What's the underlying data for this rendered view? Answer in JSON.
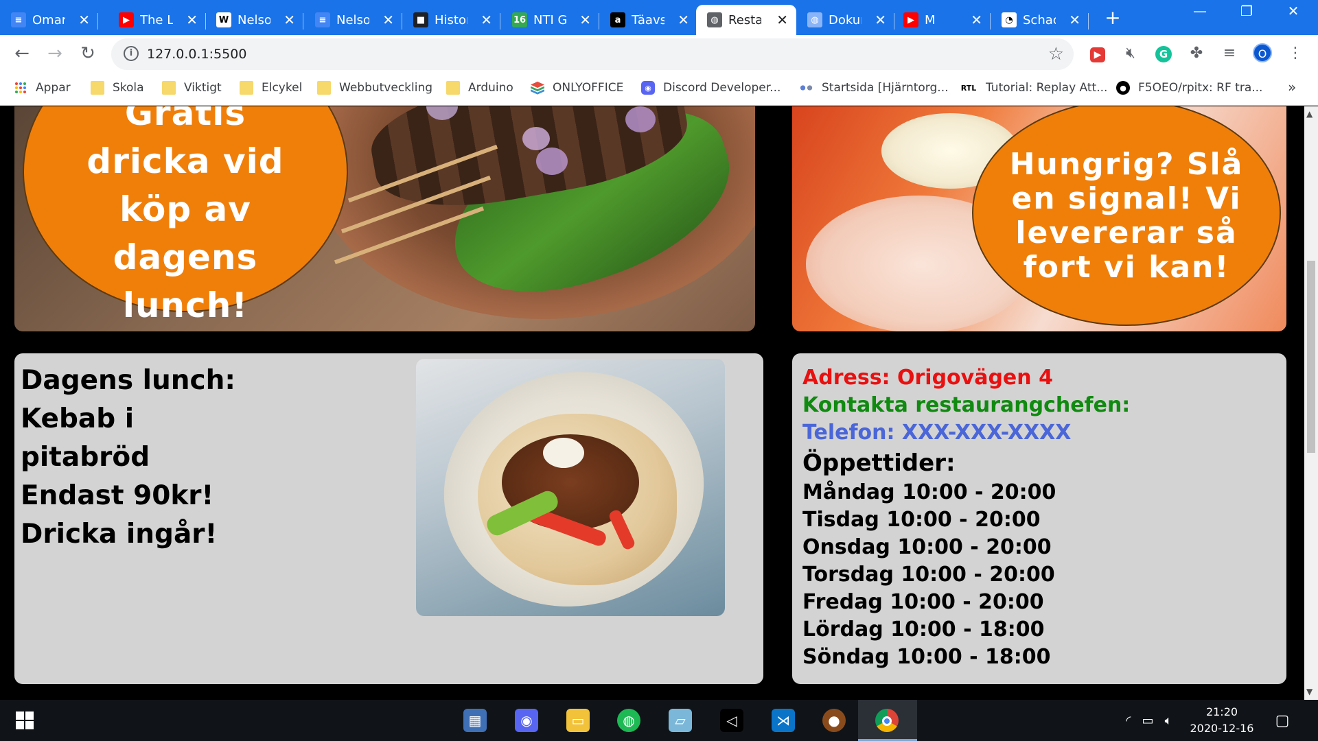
{
  "browser": {
    "tabs": [
      {
        "label": "Omar",
        "icon": "docs-icon",
        "color": "#4285f4",
        "glyph": "≡"
      },
      {
        "label": "The Li",
        "icon": "youtube-icon",
        "color": "#ff0000",
        "glyph": "▶"
      },
      {
        "label": "Nelso",
        "icon": "wikipedia-icon",
        "color": "#ffffff",
        "glyph": "W"
      },
      {
        "label": "Nelso",
        "icon": "docs-icon",
        "color": "#4285f4",
        "glyph": "≡"
      },
      {
        "label": "Histor",
        "icon": "profile-icon",
        "color": "#202124",
        "glyph": "■"
      },
      {
        "label": "NTI G",
        "icon": "calendar-icon",
        "color": "#34a853",
        "glyph": "16"
      },
      {
        "label": "Täavsl",
        "icon": "amazon-icon",
        "color": "#000000",
        "glyph": "a"
      },
      {
        "label": "Restau",
        "icon": "globe-icon",
        "color": "#5f6368",
        "glyph": "◍",
        "active": true
      },
      {
        "label": "Dokum",
        "icon": "globe-icon",
        "color": "#8ab4f8",
        "glyph": "◍"
      },
      {
        "label": "M",
        "icon": "youtube-icon",
        "color": "#ff0000",
        "glyph": "▶"
      },
      {
        "label": "Schac",
        "icon": "chess-icon",
        "color": "#ffffff",
        "glyph": "◔"
      }
    ],
    "url": "127.0.0.1:5500",
    "profile_initial": "O",
    "bookmarks": [
      {
        "label": "Appar",
        "type": "apps"
      },
      {
        "label": "Skola",
        "type": "folder"
      },
      {
        "label": "Viktigt",
        "type": "folder"
      },
      {
        "label": "Elcykel",
        "type": "folder"
      },
      {
        "label": "Webbutveckling",
        "type": "folder"
      },
      {
        "label": "Arduino",
        "type": "folder"
      },
      {
        "label": "ONLYOFFICE",
        "type": "onlyoffice"
      },
      {
        "label": "Discord Developer...",
        "type": "discord"
      },
      {
        "label": "Startsida [Hjärntorg...",
        "type": "dots"
      },
      {
        "label": "Tutorial: Replay Att...",
        "type": "rtl"
      },
      {
        "label": "F5OEO/rpitx: RF tra...",
        "type": "github"
      }
    ],
    "overflow_glyph": "»"
  },
  "page": {
    "promo_left": "Gratis dricka vid köp av dagens lunch!",
    "promo_right": "Hungrig? Slå en signal! Vi levererar så fort vi kan!",
    "lunch": {
      "lines": [
        "Dagens lunch:",
        "Kebab i",
        "pitabröd",
        "Endast 90kr!",
        "Dricka ingår!"
      ]
    },
    "info": {
      "address": "Adress: Origovägen 4",
      "contact": "Kontakta restaurangchefen:",
      "phone": "Telefon: XXX-XXX-XXXX",
      "hours_title": "Öppettider:",
      "hours": [
        "Måndag 10:00 - 20:00",
        "Tisdag 10:00 - 20:00",
        "Onsdag 10:00 - 20:00",
        "Torsdag 10:00 - 20:00",
        "Fredag 10:00 - 20:00",
        "Lördag 10:00 - 18:00",
        "Söndag 10:00 - 18:00"
      ],
      "colors": {
        "address": "#e81010",
        "contact": "#108a10",
        "phone": "#4a66d8",
        "hours": "#000000"
      }
    }
  },
  "taskbar": {
    "time": "21:20",
    "date": "2020-12-16",
    "apps": [
      "calculator-icon",
      "discord-icon",
      "file-explorer-icon",
      "spotify-icon",
      "notepad-icon",
      "unity-icon",
      "vscode-icon",
      "shoes-game-icon",
      "chrome-icon"
    ]
  }
}
